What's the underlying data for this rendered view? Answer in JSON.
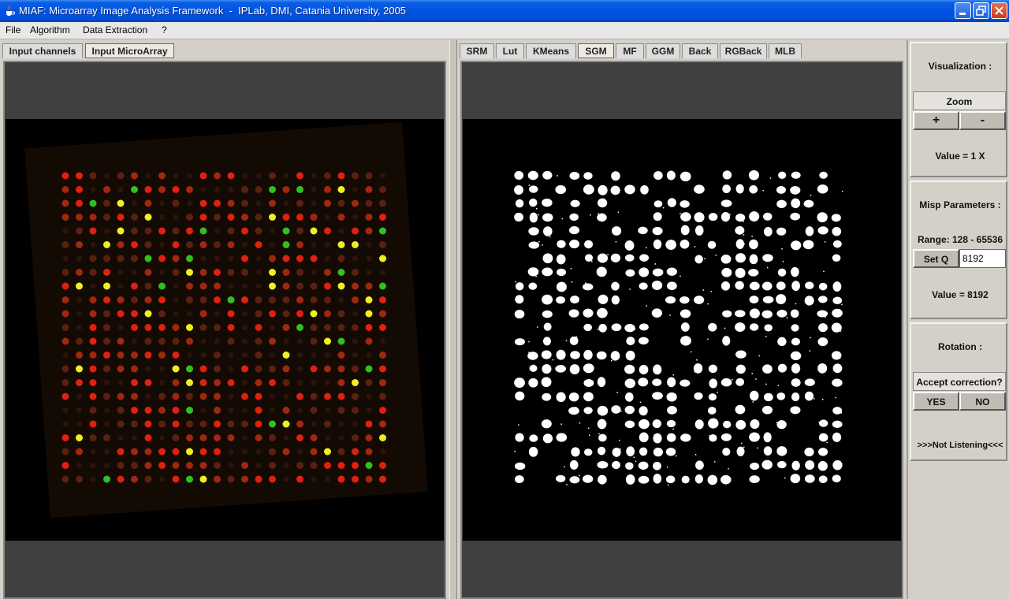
{
  "window": {
    "title": "MIAF: Microarray Image Analysis Framework  -  IPLab, DMI, Catania University, 2005"
  },
  "menu": [
    "File",
    "Algorithm",
    "Data Extraction",
    "?"
  ],
  "left_tabs": [
    "Input channels",
    "Input MicroArray"
  ],
  "left_selected_tab": "Input MicroArray",
  "right_tabs": [
    "SRM",
    "Lut",
    "KMeans",
    "SGM",
    "MF",
    "GGM",
    "Back",
    "RGBack",
    "MLB"
  ],
  "right_selected_tab": "SGM",
  "side": {
    "visualization_label": "Visualization :",
    "zoom_label": "Zoom",
    "zoom_in": "+",
    "zoom_out": "-",
    "zoom_value": "Value = 1 X",
    "misp_label": "Misp Parameters :",
    "range_label": "Range: 128 - 65536",
    "setq_button": "Set Q",
    "q_value": "8192",
    "q_value_label": "Value = 8192",
    "rotation_label": "Rotation :",
    "accept_label": "Accept correction?",
    "yes_button": "YES",
    "no_button": "NO",
    "listening_status": ">>>Not Listening<<<"
  },
  "colors": {
    "titlebar": "#0054e3",
    "spot_red": "#e02010",
    "spot_yellow": "#f0f020",
    "spot_green": "#30c020"
  },
  "icons": {
    "app": "java-cup-icon",
    "minimize": "minimize-icon",
    "maximize": "maximize-icon",
    "close": "close-icon"
  }
}
